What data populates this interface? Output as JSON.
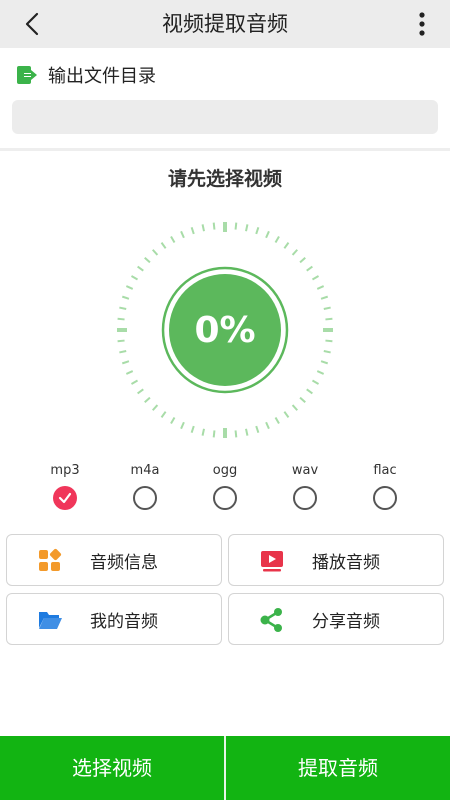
{
  "header": {
    "title": "视频提取音频"
  },
  "output": {
    "label": "输出文件目录",
    "path_value": ""
  },
  "status": {
    "message": "请先选择视频"
  },
  "progress": {
    "percent_text": "0%",
    "value": 0
  },
  "formats": {
    "selected": "mp3",
    "items": [
      {
        "label": "mp3",
        "checked": true
      },
      {
        "label": "m4a",
        "checked": false
      },
      {
        "label": "ogg",
        "checked": false
      },
      {
        "label": "wav",
        "checked": false
      },
      {
        "label": "flac",
        "checked": false
      }
    ]
  },
  "actions": {
    "audio_info": "音频信息",
    "play_audio": "播放音频",
    "my_audio": "我的音频",
    "share_audio": "分享音频"
  },
  "bottom": {
    "select_video": "选择视频",
    "extract_audio": "提取音频"
  },
  "colors": {
    "accent_green": "#12b412",
    "dial_green": "#5cb85c",
    "tick_green": "#a8dca8",
    "check_red": "#f0365a",
    "icon_orange": "#f39a2b",
    "icon_red": "#e8344a",
    "icon_blue": "#1e7be0",
    "icon_green": "#3bb34a"
  },
  "icons": {
    "back": "chevron-left-icon",
    "more": "more-vertical-icon",
    "output": "export-folder-icon",
    "audio_info": "grid-icon",
    "play_audio": "play-icon",
    "my_audio": "folder-open-icon",
    "share_audio": "share-icon",
    "check": "check-icon"
  }
}
